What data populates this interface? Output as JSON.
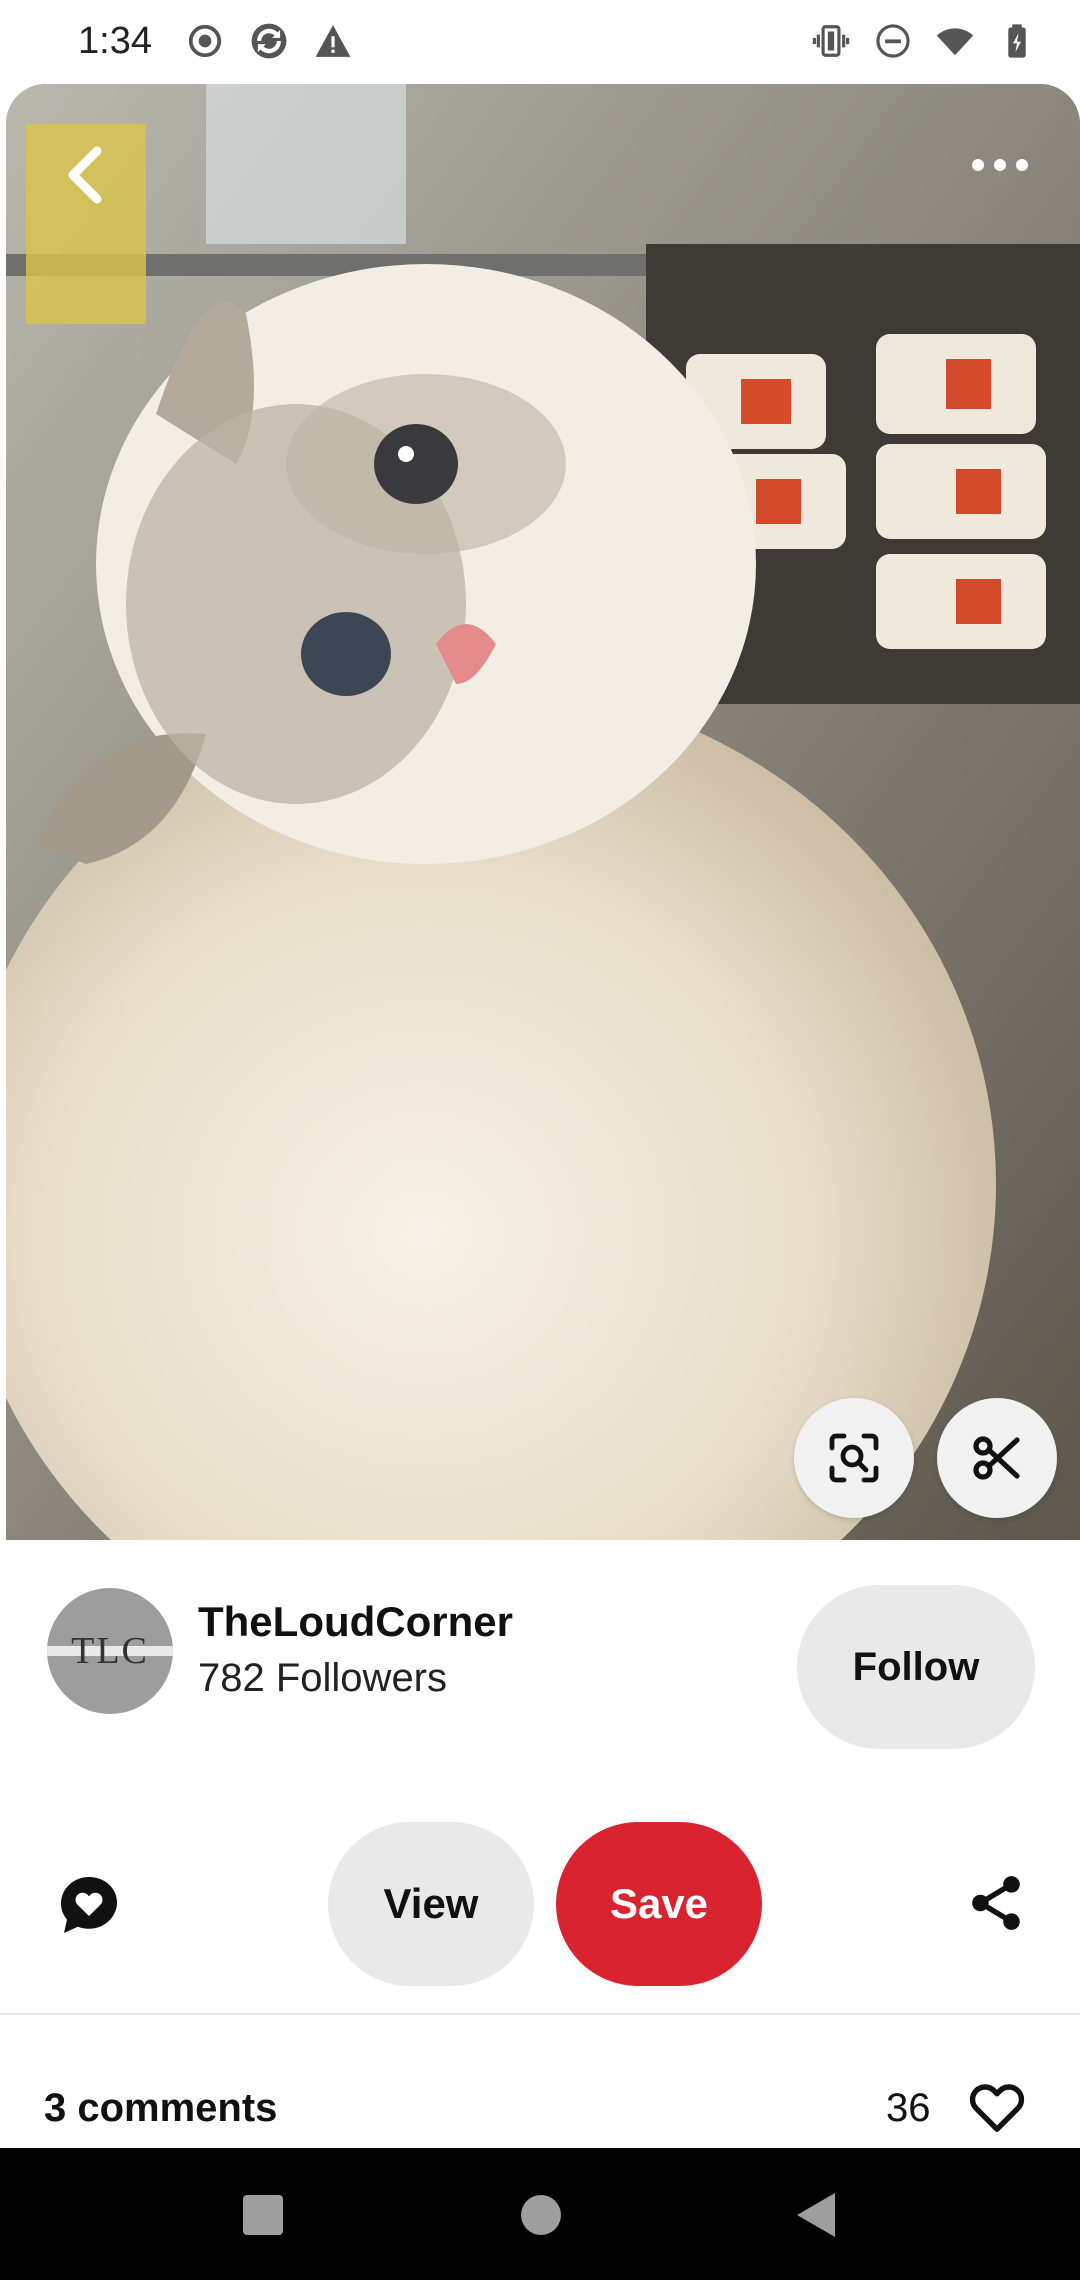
{
  "status_bar": {
    "time": "1:34",
    "left_icons": [
      "record-icon",
      "sync-icon",
      "warning-icon"
    ],
    "right_icons": [
      "vibrate-icon",
      "do-not-disturb-icon",
      "wifi-icon",
      "battery-charging-icon"
    ]
  },
  "pin": {
    "image_description_icon": "cat-photo",
    "top_left_icon": "back-chevron-icon",
    "top_right_icon": "more-options-icon",
    "image_actions": [
      "visual-search-icon",
      "scissors-icon"
    ]
  },
  "creator": {
    "avatar_text": "TLC",
    "name": "TheLoudCorner",
    "followers": "782 Followers",
    "follow_label": "Follow"
  },
  "actions": {
    "comment_icon": "comment-heart-icon",
    "view_label": "View",
    "save_label": "Save",
    "share_icon": "share-icon"
  },
  "engagement": {
    "comments_label": "3 comments",
    "likes_count": "36",
    "like_icon": "heart-outline-icon"
  },
  "nav_bar": {
    "buttons": [
      "recents-square-icon",
      "home-circle-icon",
      "back-triangle-icon"
    ]
  },
  "colors": {
    "save": "#d9232e",
    "pill_gray": "#e9e9e9",
    "nav_bg": "#000000"
  }
}
